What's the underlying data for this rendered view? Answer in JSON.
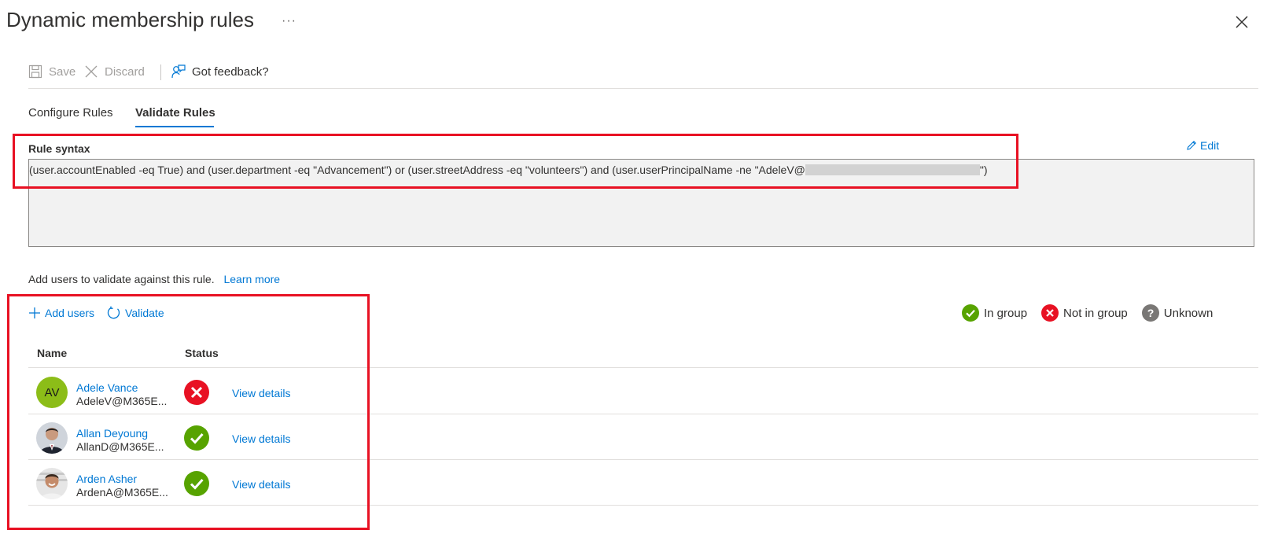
{
  "header": {
    "title": "Dynamic membership rules",
    "more": "···"
  },
  "toolbar": {
    "save_label": "Save",
    "discard_label": "Discard",
    "feedback_label": "Got feedback?"
  },
  "tabs": [
    {
      "label": "Configure Rules",
      "active": false
    },
    {
      "label": "Validate Rules",
      "active": true
    }
  ],
  "rule": {
    "label": "Rule syntax",
    "edit_label": "Edit",
    "syntax_before": "(user.accountEnabled -eq True) and (user.department -eq \"Advancement\") or (user.streetAddress -eq \"volunteers\") and (user.userPrincipalName -ne \"AdeleV@",
    "syntax_after": "\")"
  },
  "validate": {
    "description": "Add users to validate against this rule.",
    "learn_more": "Learn more",
    "add_users_label": "Add users",
    "validate_label": "Validate"
  },
  "legend": {
    "in_group": "In group",
    "not_in_group": "Not in group",
    "unknown": "Unknown"
  },
  "table": {
    "columns": {
      "name": "Name",
      "status": "Status"
    },
    "rows": [
      {
        "initials": "AV",
        "name": "Adele Vance",
        "email": "AdeleV@M365E...",
        "status": "not-in-group",
        "action": "View details"
      },
      {
        "initials": "",
        "name": "Allan Deyoung",
        "email": "AllanD@M365E...",
        "status": "in-group",
        "action": "View details"
      },
      {
        "initials": "",
        "name": "Arden Asher",
        "email": "ArdenA@M365E...",
        "status": "in-group",
        "action": "View details"
      }
    ]
  },
  "colors": {
    "accent": "#0078d4",
    "in_group": "#57a300",
    "not_in_group": "#e81123",
    "unknown": "#797775",
    "highlight": "#e81123"
  }
}
